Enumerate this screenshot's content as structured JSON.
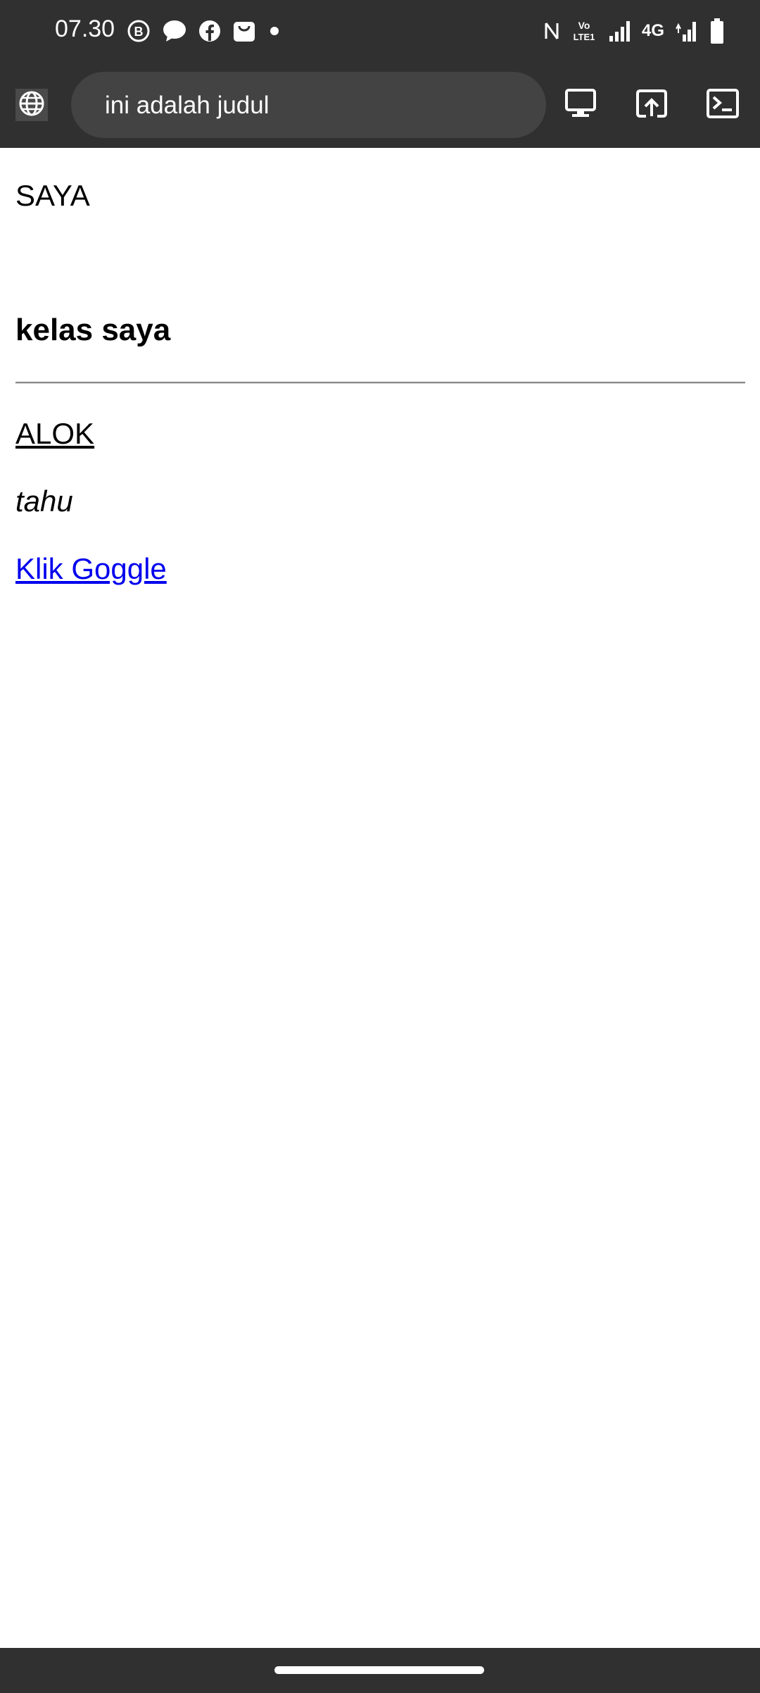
{
  "status_bar": {
    "time": "07.30",
    "notification_icons": [
      "b-chat-icon",
      "messenger-icon",
      "facebook-icon",
      "store-bag-icon",
      "dot-icon"
    ],
    "system_icons": [
      "nfc-icon",
      "volte-icon",
      "signal-icon",
      "signal-icon-2",
      "battery-icon"
    ],
    "volte_label": "Vo LTE1",
    "network_label": "4G"
  },
  "toolbar": {
    "page_title": "ini adalah judul",
    "icons": [
      "globe-icon",
      "desktop-icon",
      "open-external-icon",
      "terminal-icon"
    ]
  },
  "page": {
    "paragraph": "SAYA",
    "heading": "kelas saya",
    "underlined_text": "ALOK",
    "italic_text": "tahu",
    "link_text": "Klik Goggle",
    "link_color": "#0000ee"
  },
  "colors": {
    "chrome_bg": "#303030",
    "url_pill_bg": "#434343",
    "page_bg": "#ffffff"
  }
}
